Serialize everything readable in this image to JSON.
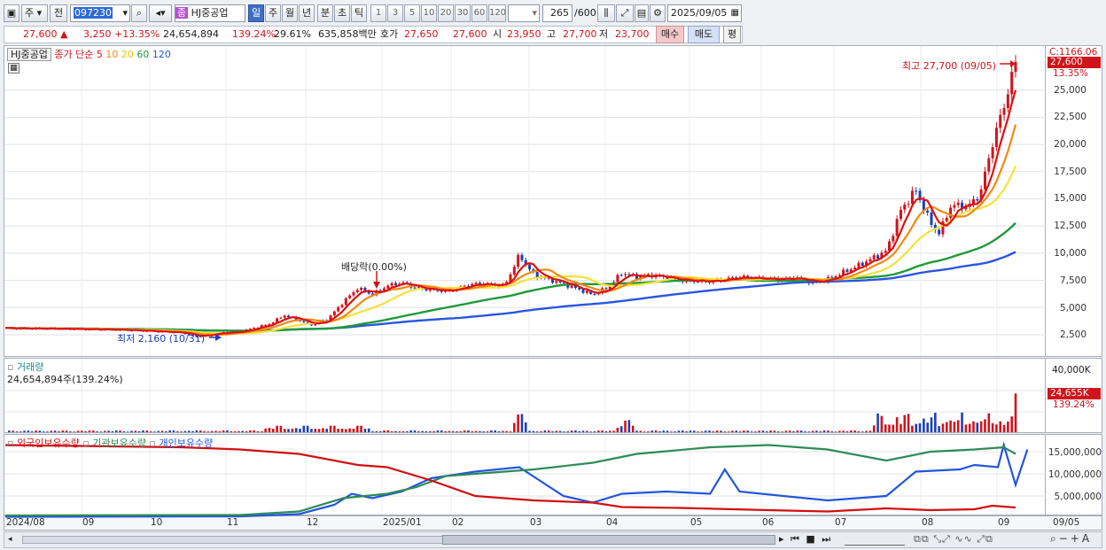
{
  "toolbar": {
    "market": "주",
    "prev": "전",
    "code": "097230",
    "stock_badge": "종",
    "stock_name": "HJ중공업",
    "periods": [
      "일",
      "주",
      "월",
      "년",
      "분",
      "초",
      "틱"
    ],
    "intervals": [
      "1",
      "3",
      "5",
      "10",
      "20",
      "30",
      "60",
      "120"
    ],
    "count": "265",
    "count_max": "/600",
    "date": "2025/09/05"
  },
  "quote": {
    "price": "27,600 ▲",
    "change": "3,250 +13.35%",
    "volume": "24,654,894",
    "vol_ratio": "139.24%",
    "turnover": "29.61%",
    "amount": "635,858백만",
    "ask_label": "호가",
    "ask": "27,650",
    "bid": "27,600",
    "open_label": "시",
    "open": "23,950",
    "high_label": "고",
    "high": "27,700",
    "low_label": "저",
    "low": "23,700",
    "buy": "매수",
    "sell": "매도",
    "eval": "평"
  },
  "price_panel": {
    "name": "HJ중공업",
    "ma_label": "종가 단순",
    "ma_periods": [
      "5",
      "10",
      "20",
      "60",
      "120"
    ],
    "cursor_label": "C:1166.06",
    "current_tag": "27,600",
    "current_pct": "13.35%",
    "high_note": "최고 27,700 (09/05)",
    "low_note": "최저 2,160 (10/31)",
    "dividend_note": "배당락(0.00%)",
    "yticks": [
      "25,000",
      "22,500",
      "20,000",
      "17,500",
      "15,000",
      "12,500",
      "10,000",
      "7,500",
      "5,000",
      "2,500"
    ]
  },
  "volume_panel": {
    "title": "거래량",
    "value": "24,654,894주(139.24%)",
    "max_tick": "40,000K",
    "current_tag": "24,655K",
    "current_pct": "139.24%"
  },
  "holdings_panel": {
    "series": [
      "외국인보유수량",
      "기관보유수량",
      "개인보유수량"
    ],
    "yticks": [
      "15,000,000",
      "10,000,000",
      "5,000,000"
    ]
  },
  "x_axis": {
    "labels": [
      "2024/08",
      "09",
      "10",
      "11",
      "12",
      "2025/01",
      "02",
      "03",
      "04",
      "05",
      "06",
      "07",
      "08",
      "09"
    ],
    "cursor_date": "09/05"
  },
  "colors": {
    "up": "#d0141c",
    "down": "#1d3fb8",
    "ma5": "#e01010",
    "ma10": "#f08a10",
    "ma20": "#f5e23a",
    "ma60": "#1f9a3a",
    "ma120": "#2a55e0",
    "foreign": "#d01010",
    "institution": "#2e8b57",
    "individual": "#2255dd"
  },
  "chart_data": {
    "type": "line",
    "title": "HJ중공업",
    "x": [
      "2024/08",
      "09",
      "10",
      "11",
      "12",
      "2025/01",
      "02",
      "03",
      "04",
      "05",
      "06",
      "07",
      "08",
      "09"
    ],
    "ylim": [
      0,
      28500
    ],
    "series": [
      {
        "name": "종가",
        "values": [
          3100,
          3000,
          2800,
          2700,
          4200,
          6800,
          6500,
          8500,
          6300,
          7700,
          7300,
          7500,
          12000,
          27600
        ]
      },
      {
        "name": "120",
        "values": [
          3100,
          3050,
          2950,
          2900,
          3000,
          3600,
          4200,
          4900,
          5600,
          6200,
          6700,
          7100,
          7600,
          9100
        ]
      }
    ],
    "volume": {
      "max": 40000,
      "last": 24655,
      "unit": "K"
    },
    "holdings": {
      "categories": [
        "2024/08",
        "11",
        "12",
        "2025/01",
        "03",
        "05",
        "07",
        "08",
        "09"
      ],
      "series": [
        {
          "name": "외국인보유수량",
          "values": [
            16500000,
            16000000,
            15000000,
            11500000,
            3500000,
            2500000,
            1500000,
            2000000,
            2500000
          ]
        },
        {
          "name": "기관보유수량",
          "values": [
            500000,
            500000,
            1500000,
            6000000,
            11000000,
            15000000,
            16000000,
            15000000,
            14500000
          ]
        },
        {
          "name": "개인보유수량",
          "values": [
            300000,
            300000,
            1000000,
            5500000,
            10500000,
            4000000,
            11000000,
            16000000,
            7500000
          ]
        }
      ]
    }
  }
}
